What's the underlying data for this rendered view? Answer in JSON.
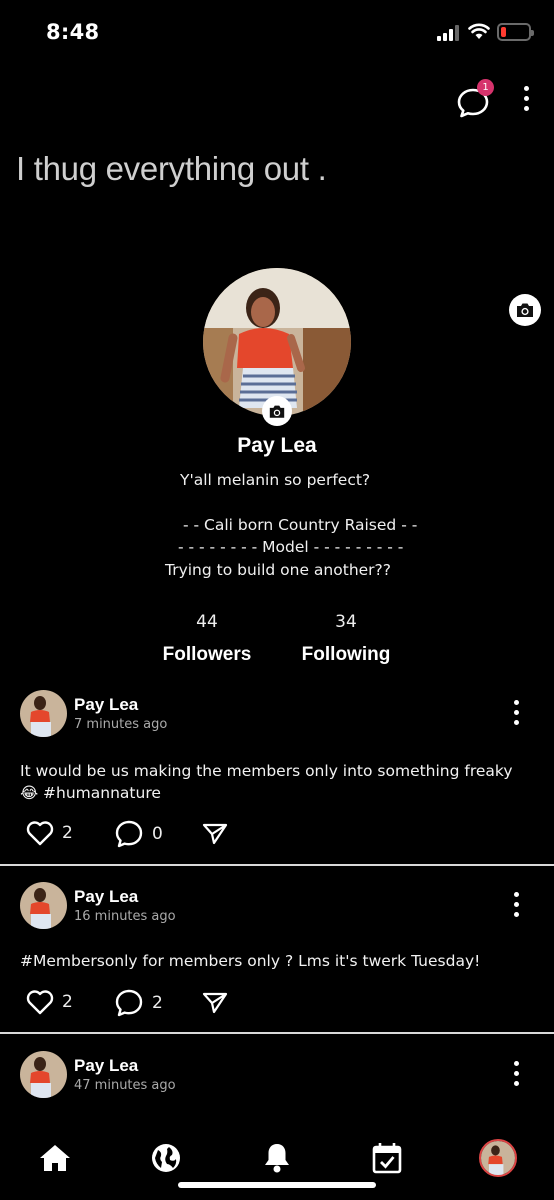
{
  "status_bar": {
    "time": "8:48"
  },
  "header": {
    "chat_badge_count": "1"
  },
  "cover": {
    "text": "I thug everything out ."
  },
  "profile": {
    "name": "Pay Lea",
    "bio_line_1": "Y'all melanin so perfect?",
    "bio_line_2": "- - Cali born Country Raised - -",
    "bio_line_3": "- - - - - - - - Model - - - - - - - - -",
    "bio_line_4": "Trying to build one another??",
    "followers_count": "44",
    "followers_label": "Followers",
    "following_count": "34",
    "following_label": "Following"
  },
  "posts": [
    {
      "author": "Pay Lea",
      "time": "7 minutes ago",
      "text_line_1": "It would be us making the members only into something freaky",
      "text_line_2": "😂 #humannature",
      "likes": "2",
      "comments": "0"
    },
    {
      "author": "Pay Lea",
      "time": "16 minutes ago",
      "text_line_1": "#Membersonly for members only ? Lms it's twerk Tuesday!",
      "likes": "2",
      "comments": "2"
    },
    {
      "author": "Pay Lea",
      "time": "47 minutes ago"
    }
  ],
  "nav": {
    "items": [
      "home-icon",
      "globe-icon",
      "bell-icon",
      "calendar-check-icon",
      "profile-avatar"
    ]
  },
  "colors": {
    "background": "#000000",
    "badge": "#d6336c",
    "battery_low": "#ff3b30",
    "divider": "#d9d9d9"
  }
}
